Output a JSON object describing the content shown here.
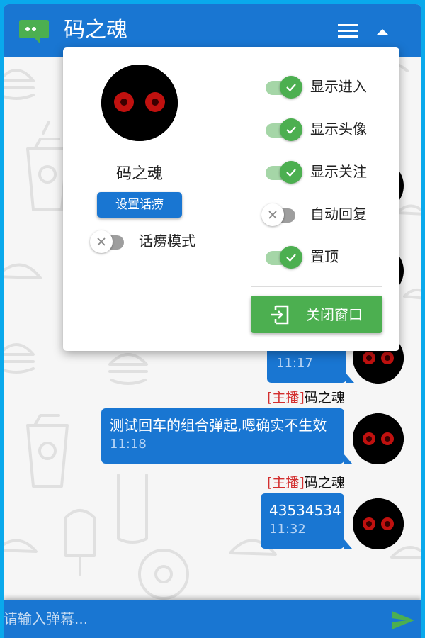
{
  "header": {
    "title": "码之魂"
  },
  "messages": [
    {
      "time": "11:17"
    },
    {
      "tag": "[主播]",
      "sender": "码之魂",
      "text": "测试回车的组合弹起,嗯确实不生效",
      "time": "11:18"
    },
    {
      "tag": "[主播]",
      "sender": "码之魂",
      "text": "43534534",
      "time": "11:32"
    }
  ],
  "panel": {
    "name": "码之魂",
    "set_chat_button": "设置话痨",
    "chat_mode_label": "话痨模式",
    "toggles": [
      {
        "label": "显示进入",
        "on": true
      },
      {
        "label": "显示头像",
        "on": true
      },
      {
        "label": "显示关注",
        "on": true
      },
      {
        "label": "自动回复",
        "on": false
      },
      {
        "label": "置顶",
        "on": true
      }
    ],
    "close_button": "关闭窗口"
  },
  "input": {
    "placeholder": "请输入弹幕..."
  },
  "colors": {
    "primary": "#1976d2",
    "accent": "#4caf50",
    "frame": "#0aa9ec",
    "tag_red": "#d32f2f"
  }
}
